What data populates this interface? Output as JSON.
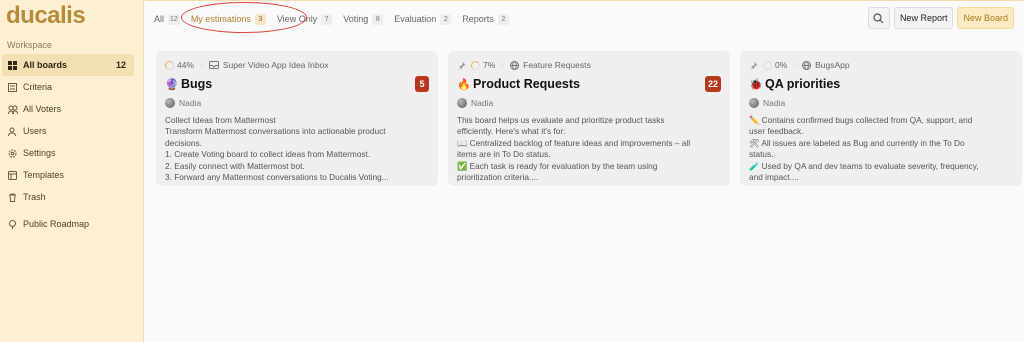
{
  "app": {
    "logo": "ducalis"
  },
  "sidebar": {
    "workspace_label": "Workspace",
    "items": [
      {
        "label": "All boards",
        "count": "12",
        "icon": "grid-icon"
      },
      {
        "label": "Criteria",
        "icon": "criteria-icon"
      },
      {
        "label": "All Voters",
        "icon": "voters-icon"
      },
      {
        "label": "Users",
        "icon": "users-icon"
      },
      {
        "label": "Settings",
        "icon": "gear-icon"
      },
      {
        "label": "Templates",
        "icon": "templates-icon"
      },
      {
        "label": "Trash",
        "icon": "trash-icon"
      },
      {
        "label": "Public Roadmap",
        "icon": "map-pin-icon"
      }
    ]
  },
  "tabs": [
    {
      "label": "All",
      "count": "12"
    },
    {
      "label": "My estimations",
      "count": "3"
    },
    {
      "label": "View Only",
      "count": "7"
    },
    {
      "label": "Voting",
      "count": "8"
    },
    {
      "label": "Evaluation",
      "count": "2"
    },
    {
      "label": "Reports",
      "count": "2"
    }
  ],
  "toolbar": {
    "new_report": "New Report",
    "new_board": "New Board"
  },
  "cards": [
    {
      "progress": "44%",
      "source": "Super Video App Idea Inbox",
      "emoji": "🔮",
      "title": "Bugs",
      "badge": "5",
      "owner": "Nadia",
      "desc": [
        "Collect Ideas from Mattermost",
        "Transform Mattermost conversations into actionable product",
        "decisions.",
        "1. Create Voting board to collect ideas from Mattermost.",
        "2. Easily connect with Mattermost bot.",
        "3. Forward any Mattermost conversations to Ducalis Voting..."
      ]
    },
    {
      "progress": "7%",
      "source": "Feature Requests",
      "emoji": "🔥",
      "title": "Product Requests",
      "badge": "22",
      "owner": "Nadia",
      "desc": [
        "This board helps us evaluate and prioritize product tasks",
        "efficiently. Here's what it's for:",
        "📖 Centralized backlog of feature ideas and improvements – all",
        "items are in To Do status.",
        "✅ Each task is ready for evaluation by the team using",
        "prioritization criteria...."
      ]
    },
    {
      "progress": "0%",
      "source": "BugsApp",
      "emoji": "🐞",
      "title": "QA priorities",
      "badge": "",
      "owner": "Nadia",
      "desc": [
        "✏️ Contains confirmed bugs collected from QA, support, and",
        "user feedback.",
        "🛠 All issues are labeled as Bug and currently in the To Do",
        "status.",
        "🧪 Used by QA and dev teams to evaluate severity, frequency,",
        "and impact...."
      ]
    }
  ],
  "colors": {
    "accent": "#b88a3a",
    "sidebar_bg": "#fdf0d2",
    "badge": "#b8381c",
    "highlight": "#d9443a"
  }
}
